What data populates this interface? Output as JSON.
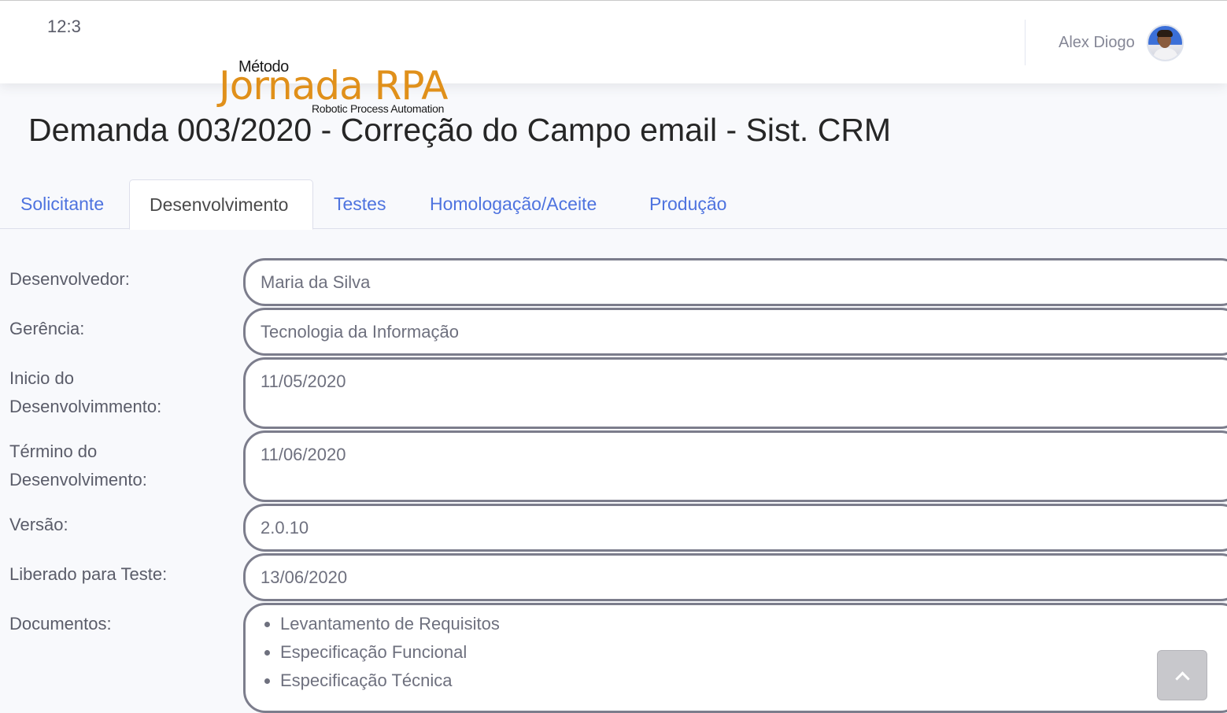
{
  "topbar": {
    "clock": "12:3",
    "user_name": "Alex Diogo"
  },
  "logo": {
    "small": "Método",
    "main": "Jornada RPA",
    "sub": "Robotic Process Automation"
  },
  "page": {
    "title": "Demanda 003/2020 - Correção do Campo email - Sist. CRM"
  },
  "tabs": [
    {
      "label": "Solicitante",
      "active": false
    },
    {
      "label": "Desenvolvimento",
      "active": true
    },
    {
      "label": "Testes",
      "active": false
    },
    {
      "label": "Homologação/Aceite",
      "active": false
    },
    {
      "label": "Produção",
      "active": false
    }
  ],
  "form": {
    "desenvolvedor": {
      "label": "Desenvolvedor:",
      "value": "Maria da Silva"
    },
    "gerencia": {
      "label": "Gerência:",
      "value": "Tecnologia da Informação"
    },
    "inicio": {
      "label_1": "Inicio do",
      "label_2": "Desenvolvimmento:",
      "value": "11/05/2020"
    },
    "termino": {
      "label_1": "Término do",
      "label_2": "Desenvolvimento:",
      "value": "11/06/2020"
    },
    "versao": {
      "label": "Versão:",
      "value": "2.0.10"
    },
    "liberado": {
      "label": "Liberado para Teste:",
      "value": "13/06/2020"
    },
    "documentos": {
      "label": "Documentos:",
      "items": [
        "Levantamento de Requisitos",
        "Especificação Funcional",
        "Especificação Técnica"
      ]
    }
  },
  "icons": {
    "scroll_top": "chevron-up-icon",
    "avatar": "user-avatar"
  },
  "colors": {
    "link": "#4e73df",
    "logo": "#e0901a",
    "field_border": "#7c7d8c"
  }
}
